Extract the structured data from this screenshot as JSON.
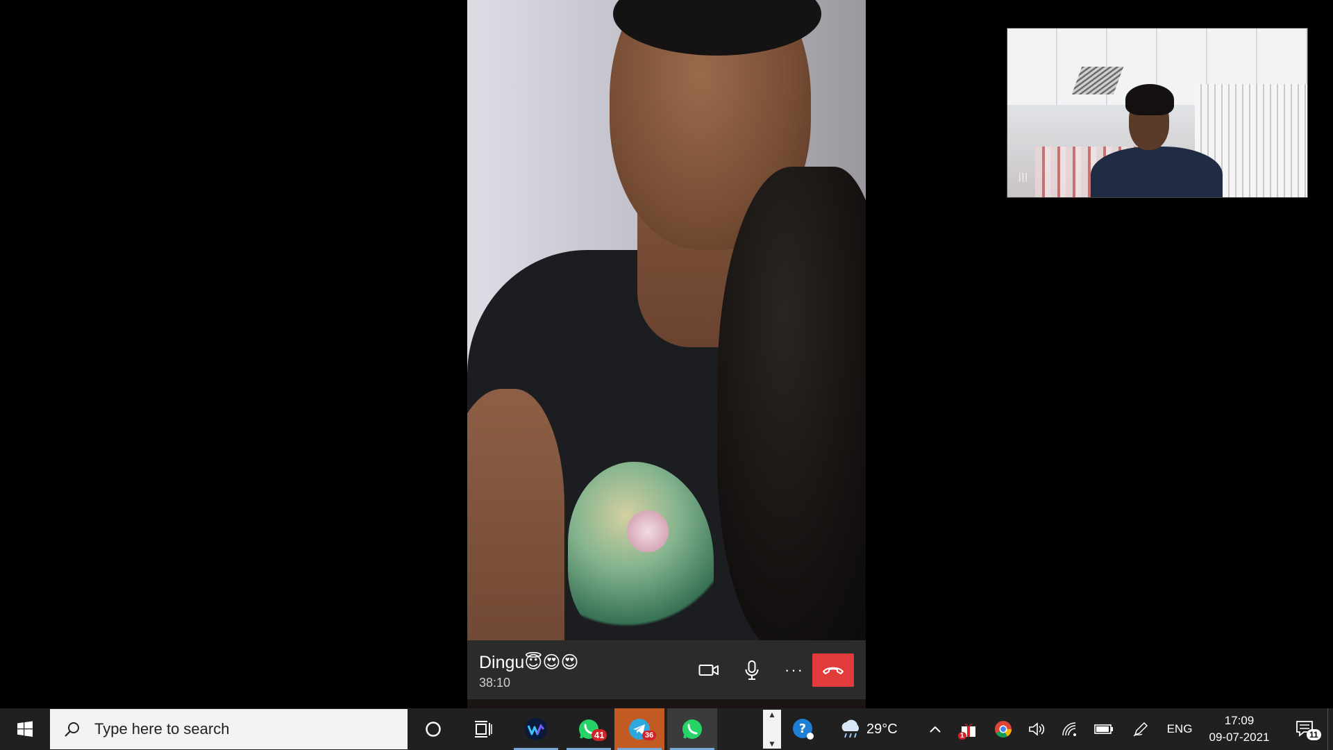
{
  "call": {
    "contact_name": "Dingu😇😍😍",
    "duration": "38:10"
  },
  "self_view": {
    "audio_indicator": "|||"
  },
  "taskbar": {
    "search_placeholder": "Type here to search",
    "whatsapp_badge": "41",
    "telegram_badge": "36",
    "temperature": "29°C",
    "language": "ENG",
    "time": "17:09",
    "date": "09-07-2021",
    "notification_count": "11",
    "security_badge": "1"
  },
  "colors": {
    "end_call": "#e23b3b",
    "call_bar": "#2b2b2b",
    "taskbar": "#202020",
    "telegram_active": "#c25a24"
  }
}
